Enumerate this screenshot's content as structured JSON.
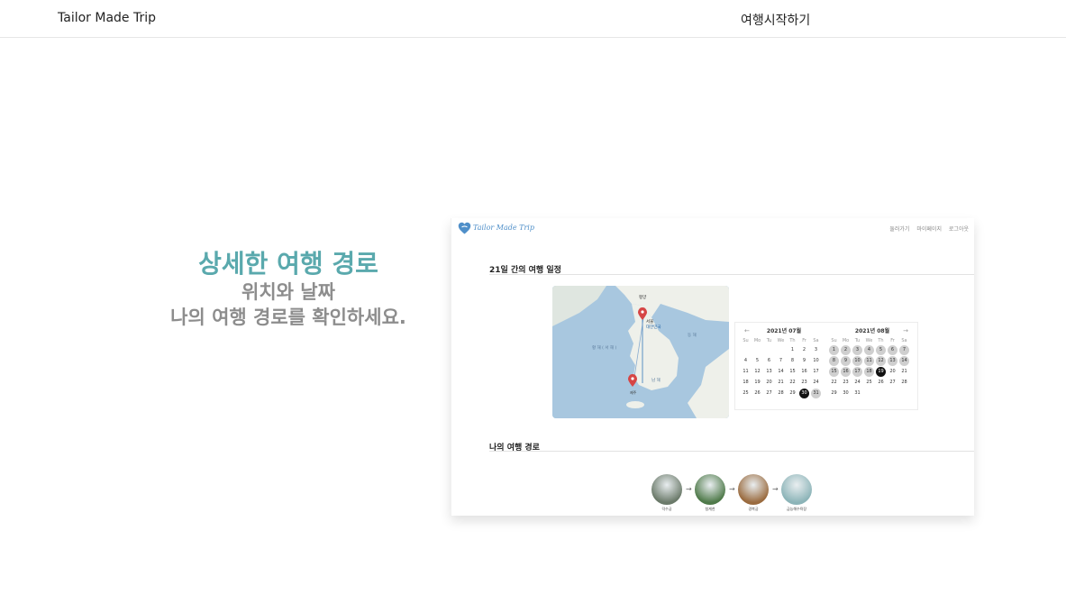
{
  "header": {
    "brand": "Tailor Made Trip",
    "start_link": "여행시작하기"
  },
  "feature": {
    "headline": "상세한 여행 경로",
    "subline1": "위치와 날짜",
    "subline2": "나의 여행 경로를 확인하세요."
  },
  "preview": {
    "logo_text": "Tailor Made Trip",
    "nav": [
      "둘러가기",
      "마이페이지",
      "로그아웃"
    ],
    "itinerary_title": "21일 간의 여행 일정",
    "route_title": "나의 여행 경로",
    "calendar": {
      "dow": [
        "Su",
        "Mo",
        "Tu",
        "We",
        "Th",
        "Fr",
        "Sa"
      ],
      "months": [
        {
          "title": "2021년 07월",
          "lead_blanks": 4,
          "days": 31,
          "in_range": [
            30,
            31
          ],
          "selected": [
            30
          ]
        },
        {
          "title": "2021년 08월",
          "lead_blanks": 0,
          "days": 31,
          "in_range": [
            1,
            2,
            3,
            4,
            5,
            6,
            7,
            8,
            9,
            10,
            11,
            12,
            13,
            14,
            15,
            16,
            17,
            18,
            19
          ],
          "selected": [
            19
          ]
        }
      ],
      "prev_arrow": "←",
      "next_arrow": "→"
    },
    "route_stops": [
      {
        "label": "덕수궁",
        "color": "#6b7a6a"
      },
      {
        "label": "청계천",
        "color": "#4f7a4a"
      },
      {
        "label": "경복궁",
        "color": "#9a6b3f"
      },
      {
        "label": "금능해수욕장",
        "color": "#8cb4b8"
      }
    ],
    "route_arrow": "→",
    "map_labels": {
      "north": "평양",
      "seoul": "서울",
      "korea": "대한민국",
      "yellow_sea": "황 해 ( 서 해 )",
      "east_sea": "동 해",
      "south_sea": "남 해",
      "jeju": "제주"
    }
  },
  "colors": {
    "accent": "#5aa9ad",
    "sub": "#8d8d8d",
    "map_sea": "#a8c7df",
    "map_land": "#eef0ea",
    "pin": "#d64545"
  }
}
